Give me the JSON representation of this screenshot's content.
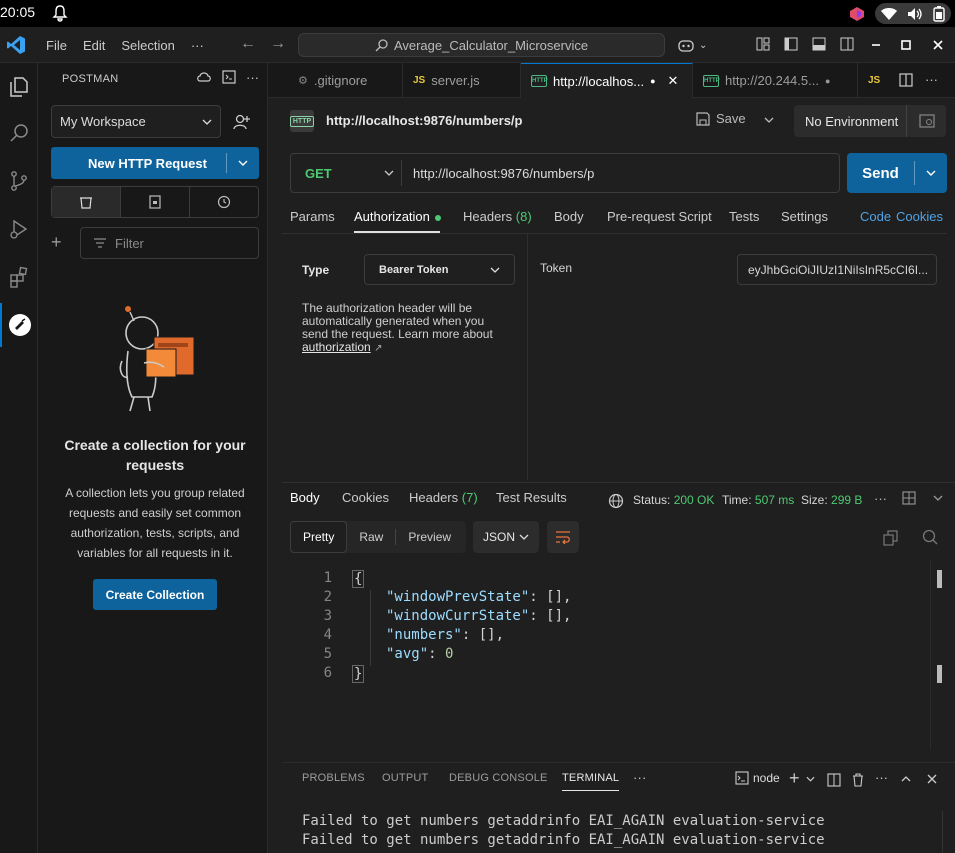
{
  "os": {
    "clock": "20:05"
  },
  "titlebar": {
    "menu": [
      "File",
      "Edit",
      "Selection",
      "···"
    ],
    "search": "Average_Calculator_Microservice"
  },
  "sidebar": {
    "header": "POSTMAN",
    "workspace": "My Workspace",
    "new_request": "New HTTP Request",
    "filter_placeholder": "Filter",
    "empty_title": "Create a collection for your requests",
    "empty_desc": "A collection lets you group related requests and easily set common authorization, tests, scripts, and variables for all requests in it.",
    "create_collection": "Create Collection"
  },
  "tabs": [
    {
      "label": ".gitignore"
    },
    {
      "label": "server.js",
      "icon": "JS"
    },
    {
      "label": "http://localhos...",
      "active": true
    },
    {
      "label": "http://20.244.5..."
    }
  ],
  "request": {
    "title": "http://localhost:9876/numbers/p",
    "save": "Save",
    "environment": "No Environment",
    "method": "GET",
    "url": "http://localhost:9876/numbers/p",
    "send": "Send"
  },
  "request_tabs": {
    "params": "Params",
    "authorization": "Authorization",
    "headers": "Headers",
    "headers_count": "(8)",
    "body": "Body",
    "prerequest": "Pre-request Script",
    "tests": "Tests",
    "settings": "Settings",
    "code": "Code",
    "cookies": "Cookies"
  },
  "auth": {
    "type_label": "Type",
    "type_value": "Bearer Token",
    "description": "The authorization header will be automatically generated when you send the request. Learn more about",
    "link": "authorization",
    "token_label": "Token",
    "token_value": "eyJhbGciOiJIUzI1NiIsInR5cCI6I..."
  },
  "response": {
    "tabs": {
      "body": "Body",
      "cookies": "Cookies",
      "headers": "Headers",
      "headers_count": "(7)",
      "tests": "Test Results"
    },
    "status_label": "Status:",
    "status_value": "200 OK",
    "time_label": "Time:",
    "time_value": "507 ms",
    "size_label": "Size:",
    "size_value": "299 B",
    "formats": [
      "Pretty",
      "Raw",
      "Preview"
    ],
    "language": "JSON",
    "lines": [
      "1",
      "2",
      "3",
      "4",
      "5",
      "6"
    ],
    "code": {
      "open": "{",
      "k1": "\"windowPrevState\"",
      "v1": ": [],",
      "k2": "\"windowCurrState\"",
      "v2": ": [],",
      "k3": "\"numbers\"",
      "v3": ": [],",
      "k4": "\"avg\"",
      "v4sep": ": ",
      "v4": "0",
      "close": "}"
    }
  },
  "panel": {
    "tabs": [
      "PROBLEMS",
      "OUTPUT",
      "DEBUG CONSOLE",
      "TERMINAL",
      "···"
    ],
    "shell": "node",
    "lines": [
      "Failed to get numbers getaddrinfo EAI_AGAIN evaluation-service",
      "Failed to get numbers getaddrinfo EAI_AGAIN evaluation-service"
    ]
  }
}
